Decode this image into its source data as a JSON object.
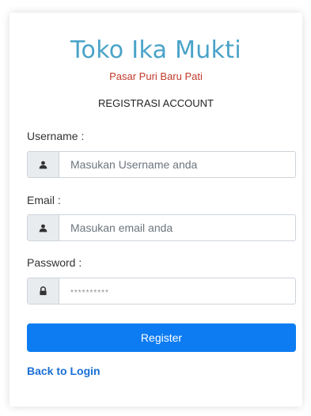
{
  "brand": {
    "title": "Toko Ika Mukti",
    "subtitle": "Pasar Puri Baru Pati"
  },
  "form": {
    "heading": "REGISTRASI ACCOUNT",
    "fields": [
      {
        "label": "Username :",
        "placeholder": "Masukan Username anda",
        "value": "",
        "icon": "user-icon"
      },
      {
        "label": "Email :",
        "placeholder": "Masukan email anda",
        "value": "",
        "icon": "user-icon"
      },
      {
        "label": "Password :",
        "placeholder": "**********",
        "value": "",
        "icon": "lock-icon"
      }
    ],
    "submit_label": "Register",
    "back_link": "Back to Login"
  },
  "colors": {
    "brand": "#4aa3c8",
    "subtitle": "#c0392b",
    "primary": "#0d7cf2",
    "link": "#1a6fd6"
  }
}
